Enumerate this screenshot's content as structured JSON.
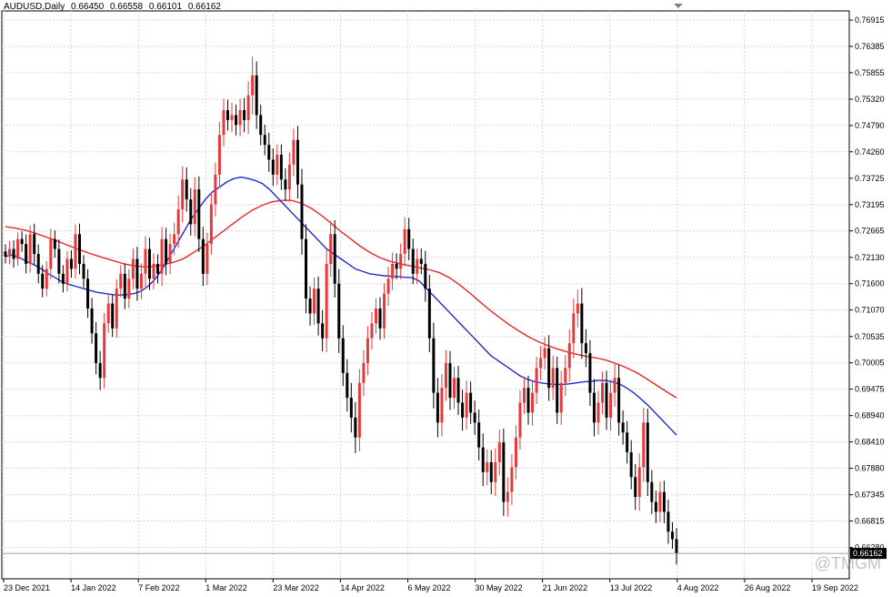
{
  "header": {
    "symbol": "AUDUSD,Daily",
    "open": "0.66450",
    "high": "0.66558",
    "low": "0.66101",
    "close": "0.66162"
  },
  "current_price_label": "0.66162",
  "watermark": "@TMGM",
  "colors": {
    "bull": "#e8393a",
    "bear": "#000000",
    "ma_fast": "#1f2bd1",
    "ma_slow": "#e8262a",
    "grid": "#d7d7d7",
    "current_price_fill": "#000000"
  },
  "chart_data": {
    "type": "candlestick",
    "grid": true,
    "y_ticks": [
      "0.76915",
      "0.76385",
      "0.75855",
      "0.75320",
      "0.74790",
      "0.74260",
      "0.73725",
      "0.73195",
      "0.72665",
      "0.72130",
      "0.71600",
      "0.71070",
      "0.70535",
      "0.70005",
      "0.69475",
      "0.68940",
      "0.68410",
      "0.67880",
      "0.67345",
      "0.66815",
      "0.66280"
    ],
    "x_ticks": [
      "23 Dec 2021",
      "14 Jan 2022",
      "7 Feb 2022",
      "1 Mar 2022",
      "23 Mar 2022",
      "14 Apr 2022",
      "6 May 2022",
      "30 May 2022",
      "21 Jun 2022",
      "13 Jul 2022",
      "4 Aug 2022",
      "26 Aug 2022",
      "19 Sep 2022"
    ],
    "ylim": [
      0.6565,
      0.771
    ],
    "candles_close": [
      0.7215,
      0.723,
      0.721,
      0.725,
      0.724,
      0.72,
      0.726,
      0.722,
      0.718,
      0.715,
      0.719,
      0.725,
      0.723,
      0.718,
      0.716,
      0.721,
      0.719,
      0.726,
      0.72,
      0.717,
      0.711,
      0.706,
      0.7,
      0.697,
      0.708,
      0.712,
      0.707,
      0.715,
      0.718,
      0.713,
      0.717,
      0.721,
      0.715,
      0.718,
      0.723,
      0.717,
      0.72,
      0.718,
      0.725,
      0.72,
      0.724,
      0.726,
      0.731,
      0.737,
      0.733,
      0.728,
      0.735,
      0.725,
      0.718,
      0.724,
      0.732,
      0.738,
      0.746,
      0.751,
      0.749,
      0.75,
      0.748,
      0.751,
      0.749,
      0.754,
      0.758,
      0.75,
      0.746,
      0.744,
      0.741,
      0.738,
      0.742,
      0.737,
      0.735,
      0.74,
      0.745,
      0.736,
      0.725,
      0.713,
      0.71,
      0.715,
      0.708,
      0.705,
      0.72,
      0.726,
      0.716,
      0.705,
      0.698,
      0.693,
      0.689,
      0.685,
      0.696,
      0.7,
      0.705,
      0.708,
      0.711,
      0.707,
      0.714,
      0.717,
      0.72,
      0.719,
      0.722,
      0.727,
      0.723,
      0.718,
      0.721,
      0.72,
      0.715,
      0.705,
      0.694,
      0.688,
      0.695,
      0.7,
      0.693,
      0.697,
      0.692,
      0.689,
      0.694,
      0.69,
      0.688,
      0.683,
      0.678,
      0.68,
      0.676,
      0.68,
      0.684,
      0.672,
      0.674,
      0.679,
      0.685,
      0.692,
      0.695,
      0.69,
      0.694,
      0.699,
      0.701,
      0.703,
      0.695,
      0.699,
      0.69,
      0.696,
      0.699,
      0.704,
      0.71,
      0.712,
      0.704,
      0.702,
      0.694,
      0.688,
      0.692,
      0.696,
      0.689,
      0.694,
      0.697,
      0.688,
      0.686,
      0.682,
      0.677,
      0.673,
      0.679,
      0.688,
      0.676,
      0.672,
      0.67,
      0.674,
      0.67,
      0.666,
      0.6645,
      0.6616
    ],
    "candles_range": [
      0.004,
      0.0045,
      0.005,
      0.004,
      0.0045,
      0.0055,
      0.005,
      0.006,
      0.0055,
      0.005,
      0.0045,
      0.006,
      0.005,
      0.0055,
      0.005,
      0.0045,
      0.005,
      0.0055,
      0.006,
      0.005,
      0.0055,
      0.006,
      0.0065,
      0.007,
      0.006,
      0.0055,
      0.005,
      0.0055,
      0.005,
      0.006,
      0.0055,
      0.006,
      0.007,
      0.006,
      0.0075,
      0.0065,
      0.006,
      0.0055,
      0.007,
      0.0065,
      0.006,
      0.0065,
      0.008,
      0.0075,
      0.007,
      0.0065,
      0.007,
      0.0075,
      0.007,
      0.0065,
      0.006,
      0.007,
      0.0075,
      0.0065,
      0.006,
      0.007,
      0.006,
      0.0065,
      0.007,
      0.008,
      0.011,
      0.008,
      0.006,
      0.006,
      0.007,
      0.0065,
      0.006,
      0.006,
      0.0065,
      0.007,
      0.0065,
      0.008,
      0.009,
      0.0085,
      0.007,
      0.0065,
      0.007,
      0.0075,
      0.008,
      0.0075,
      0.008,
      0.0085,
      0.0075,
      0.008,
      0.0085,
      0.009,
      0.008,
      0.0075,
      0.007,
      0.0065,
      0.006,
      0.0065,
      0.006,
      0.007,
      0.0065,
      0.006,
      0.006,
      0.007,
      0.0065,
      0.006,
      0.006,
      0.006,
      0.0075,
      0.008,
      0.009,
      0.0085,
      0.008,
      0.0075,
      0.007,
      0.0065,
      0.007,
      0.0075,
      0.007,
      0.0065,
      0.007,
      0.0075,
      0.008,
      0.0075,
      0.007,
      0.008,
      0.0075,
      0.008,
      0.0085,
      0.0075,
      0.007,
      0.007,
      0.0065,
      0.007,
      0.0075,
      0.0065,
      0.007,
      0.0065,
      0.0075,
      0.007,
      0.0065,
      0.007,
      0.0075,
      0.008,
      0.0085,
      0.008,
      0.009,
      0.008,
      0.0075,
      0.008,
      0.007,
      0.0065,
      0.007,
      0.0075,
      0.008,
      0.0075,
      0.007,
      0.0065,
      0.007,
      0.0075,
      0.008,
      0.0085,
      0.008,
      0.007,
      0.0065,
      0.006,
      0.0065,
      0.007,
      0.0055,
      0.0064
    ],
    "ma_fast": [
      0.7215,
      0.7218,
      0.7212,
      0.7205,
      0.7198,
      0.719,
      0.718,
      0.7172,
      0.7163,
      0.7158,
      0.7154,
      0.715,
      0.7146,
      0.7142,
      0.714,
      0.7138,
      0.7137,
      0.7138,
      0.714,
      0.7145,
      0.7155,
      0.717,
      0.719,
      0.7215,
      0.724,
      0.7265,
      0.729,
      0.731,
      0.733,
      0.7345,
      0.7355,
      0.7365,
      0.7372,
      0.7375,
      0.7372,
      0.7368,
      0.7362,
      0.735,
      0.7335,
      0.732,
      0.7305,
      0.729,
      0.7275,
      0.726,
      0.7245,
      0.723,
      0.722,
      0.721,
      0.72,
      0.719,
      0.7185,
      0.718,
      0.7178,
      0.7176,
      0.7175,
      0.7174,
      0.7173,
      0.7172,
      0.7165,
      0.715,
      0.7135,
      0.712,
      0.7105,
      0.709,
      0.7075,
      0.706,
      0.7045,
      0.703,
      0.7015,
      0.7005,
      0.6995,
      0.6985,
      0.6975,
      0.6968,
      0.6963,
      0.696,
      0.6958,
      0.6957,
      0.6957,
      0.6958,
      0.696,
      0.6962,
      0.6963,
      0.6965,
      0.6965,
      0.6962,
      0.6958,
      0.695,
      0.694,
      0.6928,
      0.6915,
      0.69,
      0.6885,
      0.687,
      0.6855
    ],
    "ma_slow": [
      0.7275,
      0.7272,
      0.7268,
      0.7262,
      0.7255,
      0.7248,
      0.724,
      0.7232,
      0.7225,
      0.7218,
      0.7212,
      0.7206,
      0.72,
      0.7196,
      0.7194,
      0.7195,
      0.7198,
      0.7203,
      0.721,
      0.7222,
      0.7235,
      0.725,
      0.7265,
      0.728,
      0.7295,
      0.7308,
      0.7318,
      0.7325,
      0.7328,
      0.7328,
      0.7322,
      0.7312,
      0.7298,
      0.7282,
      0.7265,
      0.725,
      0.7235,
      0.7222,
      0.7212,
      0.7205,
      0.72,
      0.7196,
      0.7192,
      0.7188,
      0.7182,
      0.7172,
      0.7158,
      0.7142,
      0.7125,
      0.7108,
      0.7093,
      0.7078,
      0.7065,
      0.7053,
      0.7043,
      0.7035,
      0.7028,
      0.7022,
      0.7017,
      0.7013,
      0.701,
      0.7005,
      0.6998,
      0.699,
      0.698,
      0.6968,
      0.6955,
      0.6942,
      0.693
    ]
  }
}
